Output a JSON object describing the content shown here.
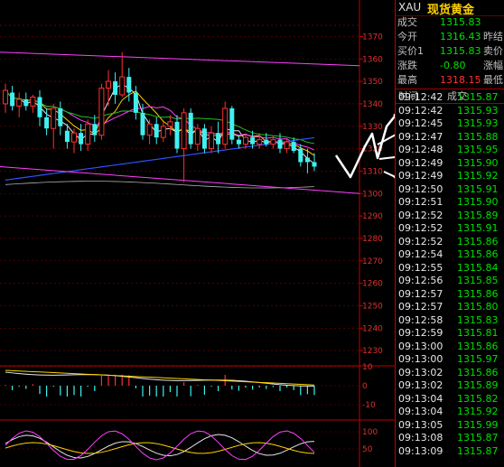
{
  "header": {
    "symbol": "XAU",
    "name": "现货黄金",
    "colors": {
      "symbol": "#e0e0e0",
      "name": "#ffd000"
    }
  },
  "quote": [
    {
      "label": "成交",
      "value": "1315.83",
      "extra": "",
      "color": "#00e000"
    },
    {
      "label": "今开",
      "value": "1316.43",
      "extra": "昨结",
      "color": "#00e000"
    },
    {
      "label": "买价1",
      "value": "1315.83",
      "extra": "卖价",
      "color": "#00e000"
    },
    {
      "label": "涨跌",
      "value": "-0.80",
      "extra": "涨幅",
      "color": "#00e000"
    },
    {
      "label": "最高",
      "value": "1318.15",
      "extra": "最低",
      "color": "#ff3030"
    }
  ],
  "ticks_header": {
    "time": "时间",
    "price": "成交"
  },
  "ticks": [
    {
      "time": "09:12:42",
      "price": "1315.87"
    },
    {
      "time": "09:12:42",
      "price": "1315.93"
    },
    {
      "time": "09:12:45",
      "price": "1315.93"
    },
    {
      "time": "09:12:47",
      "price": "1315.88"
    },
    {
      "time": "09:12:48",
      "price": "1315.95"
    },
    {
      "time": "09:12:49",
      "price": "1315.90"
    },
    {
      "time": "09:12:49",
      "price": "1315.92"
    },
    {
      "time": "09:12:50",
      "price": "1315.91"
    },
    {
      "time": "09:12:51",
      "price": "1315.90"
    },
    {
      "time": "09:12:52",
      "price": "1315.89"
    },
    {
      "time": "09:12:52",
      "price": "1315.91"
    },
    {
      "time": "09:12:52",
      "price": "1315.86"
    },
    {
      "time": "09:12:54",
      "price": "1315.86"
    },
    {
      "time": "09:12:55",
      "price": "1315.84"
    },
    {
      "time": "09:12:56",
      "price": "1315.85"
    },
    {
      "time": "09:12:57",
      "price": "1315.86"
    },
    {
      "time": "09:12:57",
      "price": "1315.80"
    },
    {
      "time": "09:12:58",
      "price": "1315.83"
    },
    {
      "time": "09:12:59",
      "price": "1315.81"
    },
    {
      "time": "09:13:00",
      "price": "1315.86"
    },
    {
      "time": "09:13:00",
      "price": "1315.97"
    },
    {
      "time": "09:13:02",
      "price": "1315.86"
    },
    {
      "time": "09:13:02",
      "price": "1315.89"
    },
    {
      "time": "09:13:04",
      "price": "1315.82"
    },
    {
      "time": "09:13:04",
      "price": "1315.92"
    },
    {
      "time": "09:13:05",
      "price": "1315.99"
    },
    {
      "time": "09:13:08",
      "price": "1315.87"
    },
    {
      "time": "09:13:09",
      "price": "1315.87"
    }
  ],
  "chart_data": {
    "type": "candlestick",
    "price_axis": {
      "ticks": [
        1370,
        1360,
        1350,
        1340,
        1330,
        1320,
        1310,
        1300,
        1290,
        1280,
        1270,
        1260,
        1250,
        1240,
        1230
      ],
      "ylim": [
        1224,
        1375
      ]
    },
    "macd_axis": {
      "ticks": [
        10,
        0,
        -10
      ]
    },
    "kdj_axis": {
      "ticks": [
        100,
        50
      ]
    },
    "candles": [
      {
        "o": 1340,
        "h": 1349,
        "l": 1336,
        "c": 1346
      },
      {
        "o": 1345,
        "h": 1348,
        "l": 1337,
        "c": 1339
      },
      {
        "o": 1339,
        "h": 1345,
        "l": 1334,
        "c": 1342
      },
      {
        "o": 1342,
        "h": 1345,
        "l": 1337,
        "c": 1339
      },
      {
        "o": 1339,
        "h": 1344,
        "l": 1336,
        "c": 1343
      },
      {
        "o": 1343,
        "h": 1346,
        "l": 1330,
        "c": 1334
      },
      {
        "o": 1334,
        "h": 1338,
        "l": 1326,
        "c": 1329
      },
      {
        "o": 1329,
        "h": 1340,
        "l": 1320,
        "c": 1338
      },
      {
        "o": 1338,
        "h": 1341,
        "l": 1326,
        "c": 1330
      },
      {
        "o": 1328,
        "h": 1331,
        "l": 1320,
        "c": 1323
      },
      {
        "o": 1323,
        "h": 1329,
        "l": 1318,
        "c": 1327
      },
      {
        "o": 1327,
        "h": 1331,
        "l": 1319,
        "c": 1322
      },
      {
        "o": 1322,
        "h": 1333,
        "l": 1319,
        "c": 1331
      },
      {
        "o": 1331,
        "h": 1335,
        "l": 1323,
        "c": 1326
      },
      {
        "o": 1326,
        "h": 1349,
        "l": 1324,
        "c": 1347
      },
      {
        "o": 1347,
        "h": 1355,
        "l": 1339,
        "c": 1350
      },
      {
        "o": 1350,
        "h": 1354,
        "l": 1340,
        "c": 1344
      },
      {
        "o": 1344,
        "h": 1363,
        "l": 1343,
        "c": 1352
      },
      {
        "o": 1352,
        "h": 1356,
        "l": 1341,
        "c": 1345
      },
      {
        "o": 1345,
        "h": 1348,
        "l": 1333,
        "c": 1336
      },
      {
        "o": 1336,
        "h": 1340,
        "l": 1324,
        "c": 1326
      },
      {
        "o": 1326,
        "h": 1333,
        "l": 1322,
        "c": 1331
      },
      {
        "o": 1331,
        "h": 1334,
        "l": 1322,
        "c": 1325
      },
      {
        "o": 1325,
        "h": 1332,
        "l": 1323,
        "c": 1330
      },
      {
        "o": 1330,
        "h": 1335,
        "l": 1326,
        "c": 1332
      },
      {
        "o": 1332,
        "h": 1335,
        "l": 1318,
        "c": 1320
      },
      {
        "o": 1320,
        "h": 1338,
        "l": 1305,
        "c": 1336
      },
      {
        "o": 1336,
        "h": 1338,
        "l": 1320,
        "c": 1322
      },
      {
        "o": 1322,
        "h": 1331,
        "l": 1319,
        "c": 1329
      },
      {
        "o": 1329,
        "h": 1331,
        "l": 1318,
        "c": 1320
      },
      {
        "o": 1320,
        "h": 1330,
        "l": 1318,
        "c": 1327
      },
      {
        "o": 1327,
        "h": 1332,
        "l": 1318,
        "c": 1322
      },
      {
        "o": 1322,
        "h": 1341,
        "l": 1320,
        "c": 1338
      },
      {
        "o": 1338,
        "h": 1339,
        "l": 1322,
        "c": 1324
      },
      {
        "o": 1324,
        "h": 1326,
        "l": 1320,
        "c": 1322
      },
      {
        "o": 1322,
        "h": 1326,
        "l": 1320,
        "c": 1325
      },
      {
        "o": 1325,
        "h": 1328,
        "l": 1320,
        "c": 1322
      },
      {
        "o": 1322,
        "h": 1327,
        "l": 1320,
        "c": 1324
      },
      {
        "o": 1324,
        "h": 1327,
        "l": 1321,
        "c": 1322
      },
      {
        "o": 1322,
        "h": 1326,
        "l": 1320,
        "c": 1324
      },
      {
        "o": 1324,
        "h": 1327,
        "l": 1318,
        "c": 1320
      },
      {
        "o": 1320,
        "h": 1324,
        "l": 1318,
        "c": 1323
      },
      {
        "o": 1323,
        "h": 1325,
        "l": 1318,
        "c": 1319
      },
      {
        "o": 1320,
        "h": 1322,
        "l": 1312,
        "c": 1314
      },
      {
        "o": 1316,
        "h": 1320,
        "l": 1309,
        "c": 1314
      },
      {
        "o": 1314,
        "h": 1318,
        "l": 1310,
        "c": 1312
      }
    ],
    "colors": {
      "up": "#ff3030",
      "down": "#40f0f0",
      "ma_white": "#e8e8e8",
      "ma_yellow": "#ffd000",
      "ma_magenta": "#ff40ff",
      "ma_green": "#20c020",
      "ma_blue": "#3050ff",
      "grid": "#800000",
      "border": "#c00000"
    }
  }
}
